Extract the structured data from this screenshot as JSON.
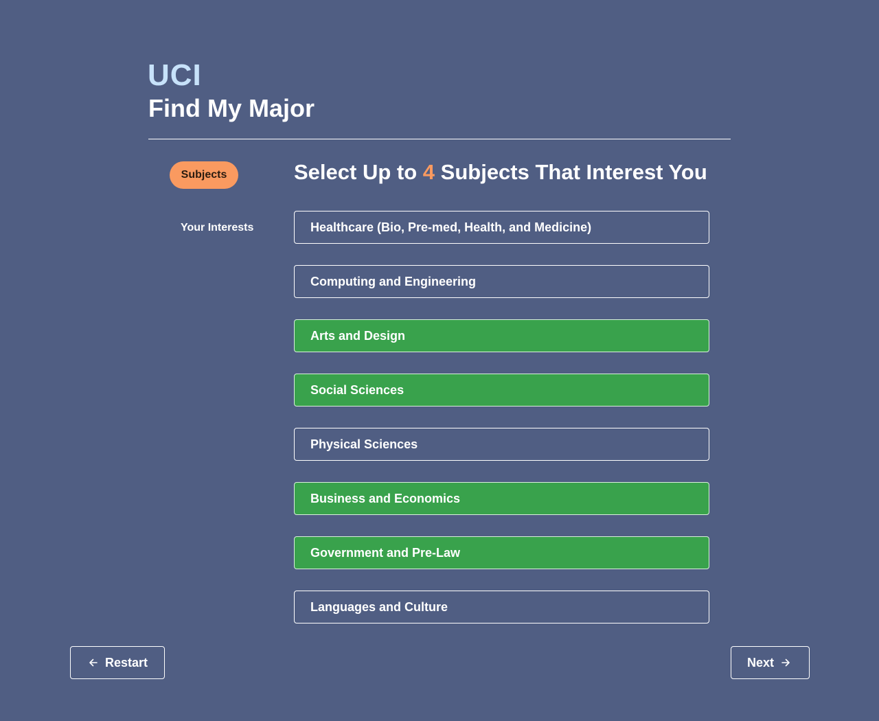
{
  "header": {
    "logo": "UCI",
    "title": "Find My Major"
  },
  "steps": {
    "current": "Subjects",
    "next": "Your Interests"
  },
  "heading": {
    "prefix": "Select Up to",
    "count": "4",
    "suffix": "Subjects That Interest You"
  },
  "options": [
    {
      "label": "Healthcare (Bio, Pre-med, Health, and Medicine)",
      "selected": false
    },
    {
      "label": "Computing and Engineering",
      "selected": false
    },
    {
      "label": "Arts and Design",
      "selected": true
    },
    {
      "label": "Social Sciences",
      "selected": true
    },
    {
      "label": "Physical Sciences",
      "selected": false
    },
    {
      "label": "Business and Economics",
      "selected": true
    },
    {
      "label": "Government and Pre-Law",
      "selected": true
    },
    {
      "label": "Languages and Culture",
      "selected": false
    }
  ],
  "nav": {
    "restart_label": "Restart",
    "restart_icon": "arrow-left-icon",
    "next_label": "Next",
    "next_icon": "arrow-right-icon"
  },
  "colors": {
    "background": "#505e83",
    "accent": "#fa9a60",
    "selected": "#39a24c",
    "logo": "#c7e2fa"
  }
}
